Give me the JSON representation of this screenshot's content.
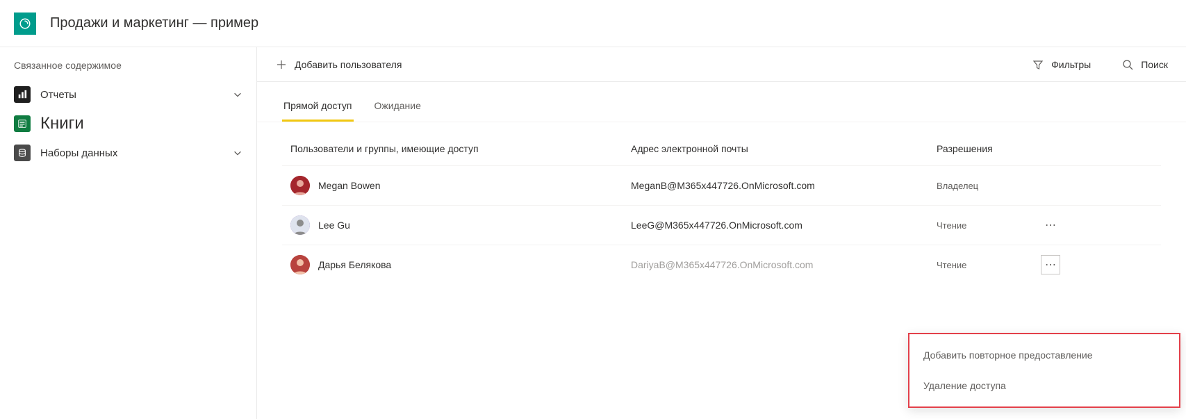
{
  "header": {
    "title": "Продажи и маркетинг — пример"
  },
  "sidebar": {
    "title": "Связанное содержимое",
    "items": [
      {
        "label": "Отчеты",
        "icon": "reports-icon",
        "expandable": true,
        "selected": false
      },
      {
        "label": "Книги",
        "icon": "books-icon",
        "expandable": false,
        "selected": true
      },
      {
        "label": "Наборы данных",
        "icon": "datasets-icon",
        "expandable": true,
        "selected": false
      }
    ]
  },
  "toolbar": {
    "add_user": "Добавить пользователя",
    "filters": "Фильтры",
    "search": "Поиск"
  },
  "tabs": [
    {
      "label": "Прямой доступ",
      "active": true
    },
    {
      "label": "Ожидание",
      "active": false
    }
  ],
  "table": {
    "columns": {
      "user": "Пользователи и группы, имеющие доступ",
      "email": "Адрес электронной почты",
      "perm": "Разрешения"
    },
    "rows": [
      {
        "name": "Megan Bowen",
        "email": "MeganB@M365x447726.OnMicrosoft.com",
        "perm": "Владелец",
        "has_menu": false,
        "dim": false
      },
      {
        "name": "Lee Gu",
        "email": "LeeG@M365x447726.OnMicrosoft.com",
        "perm": "Чтение",
        "has_menu": true,
        "menu_active": false,
        "dim": false
      },
      {
        "name": "Дарья Белякова",
        "email": "DariyaB@M365x447726.OnMicrosoft.com",
        "perm": "Чтение",
        "has_menu": true,
        "menu_active": true,
        "dim": true
      }
    ]
  },
  "context_menu": {
    "items": [
      "Добавить повторное предоставление",
      "Удаление доступа"
    ]
  }
}
